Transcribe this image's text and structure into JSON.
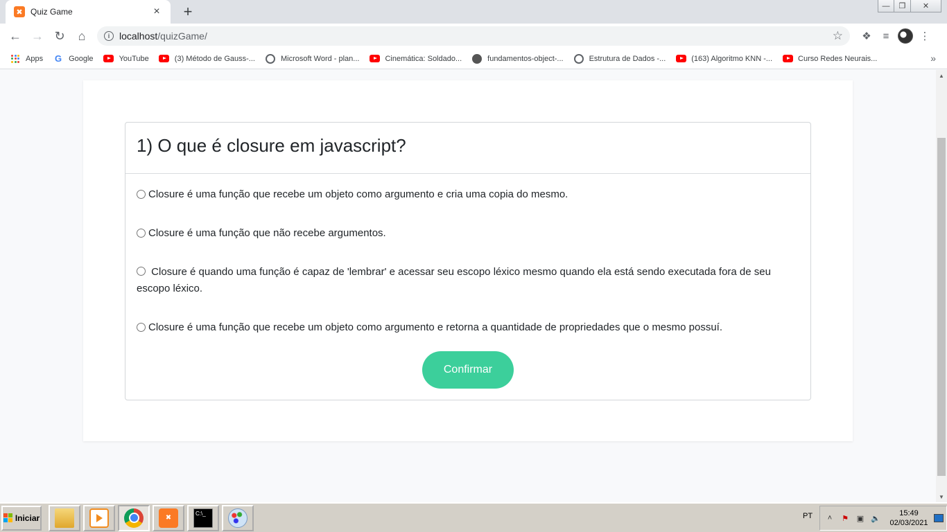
{
  "browser": {
    "tab_title": "Quiz Game",
    "tab_close": "×",
    "new_tab": "+",
    "url_host": "localhost",
    "url_path": "/quizGame/",
    "window_controls": {
      "minimize": "—",
      "restore": "❐",
      "close": "✕"
    }
  },
  "bookmarks": [
    {
      "label": "Apps",
      "icon": "apps-grid-icon"
    },
    {
      "label": "Google",
      "icon": "google-icon"
    },
    {
      "label": "YouTube",
      "icon": "youtube-icon"
    },
    {
      "label": "(3) Método de Gauss-...",
      "icon": "youtube-icon"
    },
    {
      "label": "Microsoft Word - plan...",
      "icon": "globe-icon"
    },
    {
      "label": "Cinemática: Soldado...",
      "icon": "youtube-icon"
    },
    {
      "label": "fundamentos-object-...",
      "icon": "github-icon"
    },
    {
      "label": "Estrutura de Dados -...",
      "icon": "globe-icon"
    },
    {
      "label": "(163) Algoritmo KNN -...",
      "icon": "youtube-icon"
    },
    {
      "label": "Curso Redes Neurais...",
      "icon": "youtube-icon"
    }
  ],
  "quiz": {
    "question": "1) O que é closure em javascript?",
    "options": [
      "Closure é uma função que recebe um objeto como argumento e cria uma copia do mesmo.",
      "Closure é uma função que não recebe argumentos.",
      "Closure é quando uma função é capaz de 'lembrar' e acessar seu escopo léxico mesmo quando ela está sendo executada fora de seu escopo léxico.",
      "Closure é uma função que recebe um objeto como argumento e retorna a quantidade de propriedades que o mesmo possuí."
    ],
    "confirm_label": "Confirmar",
    "accent_color": "#3ccf9b"
  },
  "taskbar": {
    "start_label": "Iniciar",
    "language": "PT",
    "time": "15:49",
    "date": "02/03/2021"
  }
}
